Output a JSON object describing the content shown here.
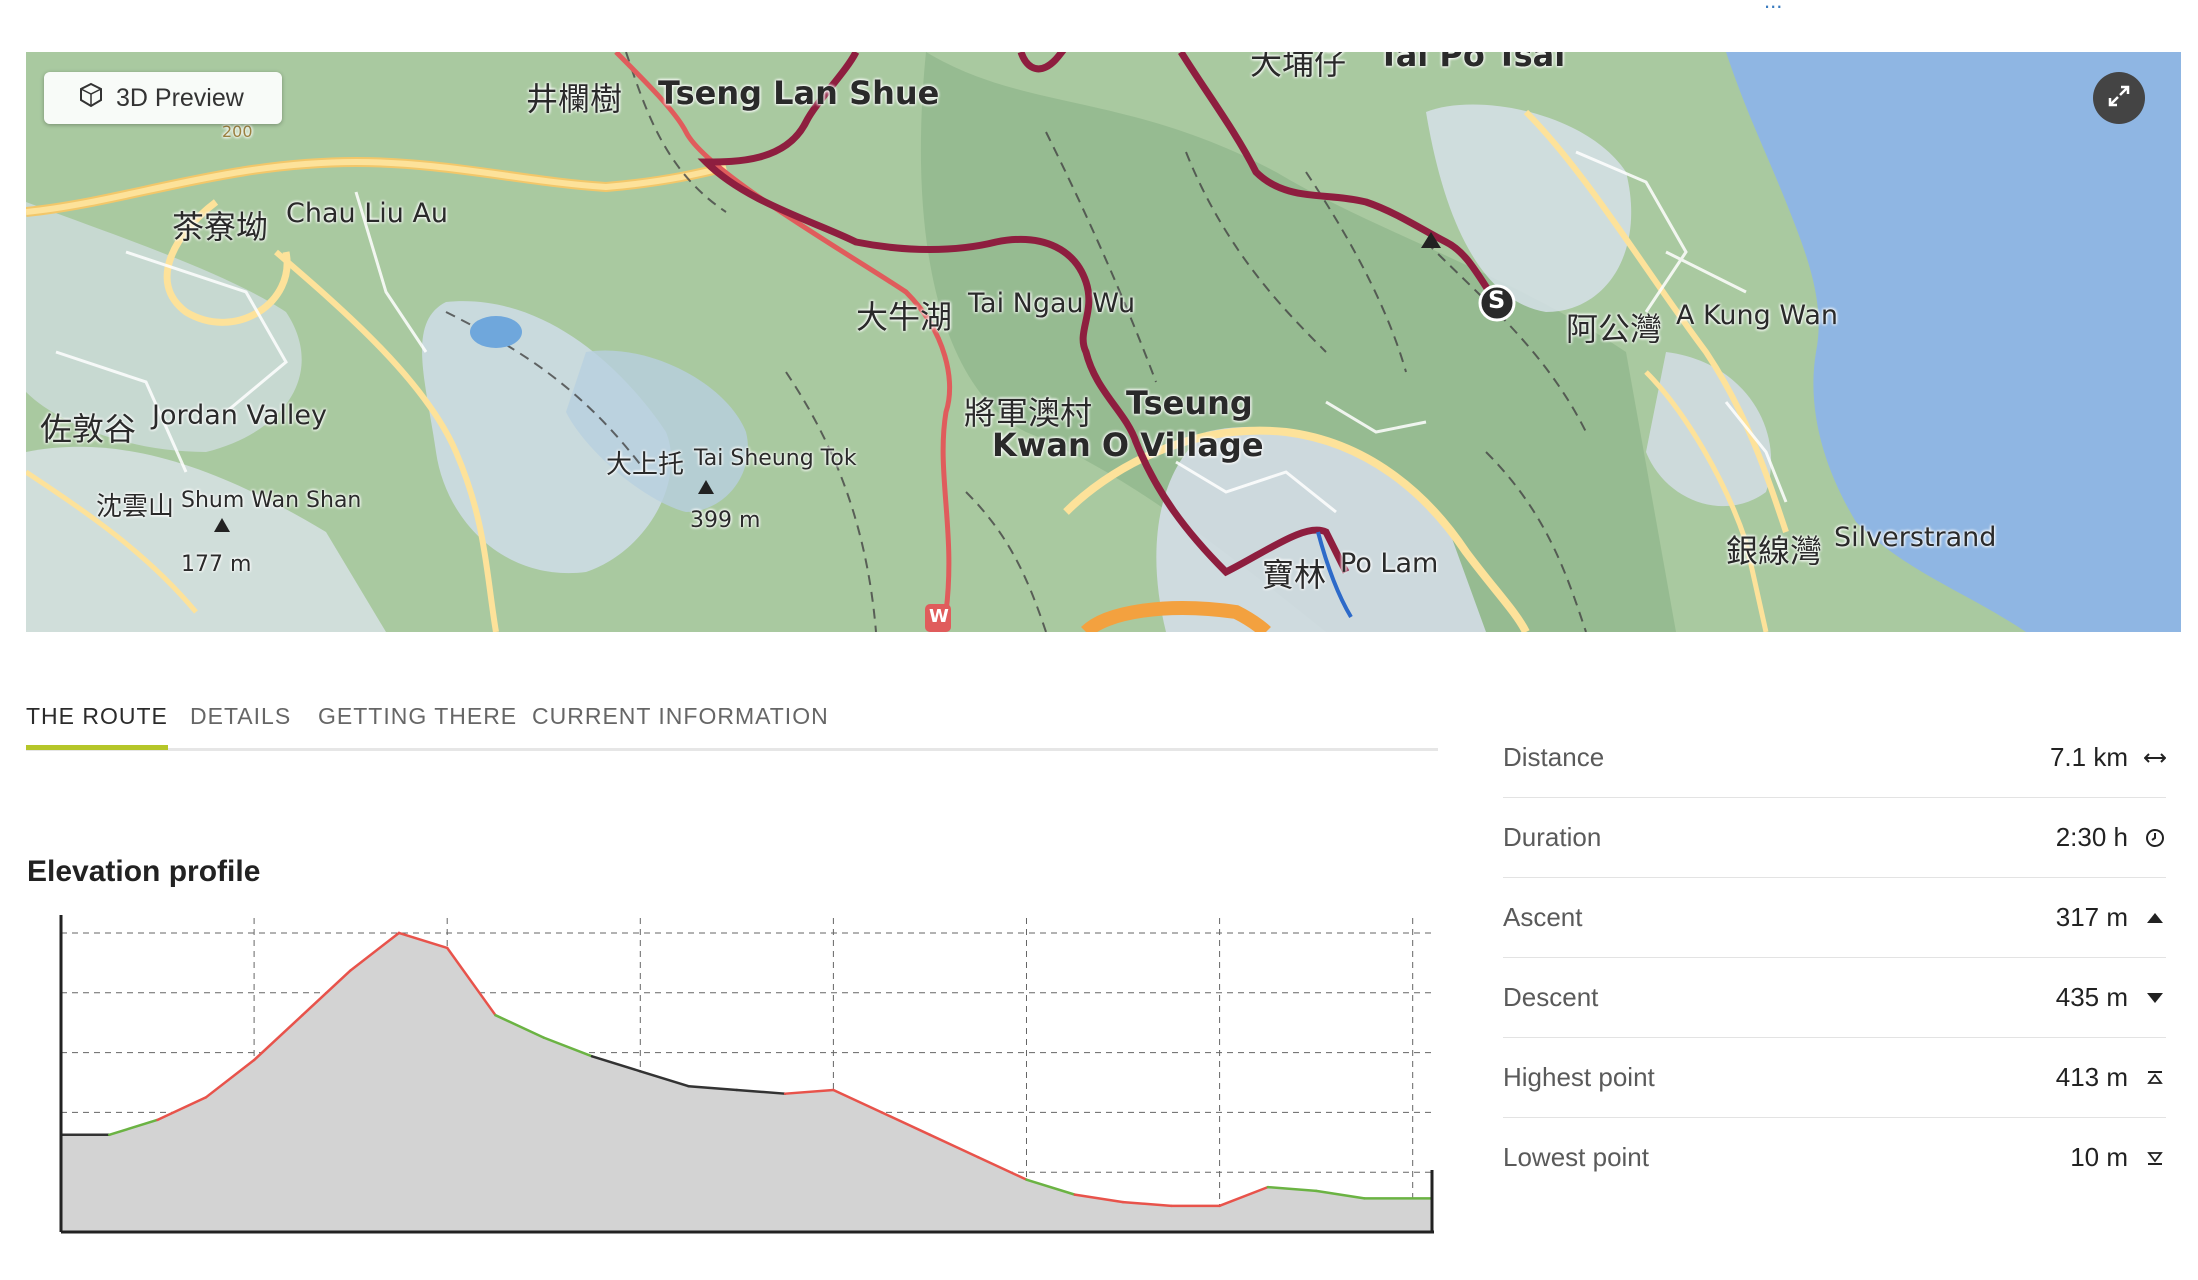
{
  "top_link": "...",
  "map": {
    "preview_button": "3D Preview",
    "labels": {
      "tseng_lan_shue_cn": "井欄樹",
      "tseng_lan_shue": "Tseng Lan Shue",
      "chau_liu_au_cn": "茶寮坳",
      "chau_liu_au": "Chau Liu Au",
      "tai_ngau_wu_cn": "大牛湖",
      "tai_ngau_wu": "Tai Ngau Wu",
      "tseung_kwan_o_cn": "將軍澳村",
      "tseung_kwan_o": "Tseung",
      "tseung_kwan_o_2": "Kwan O Village",
      "jordan_valley_cn": "佐敦谷",
      "jordan_valley": "Jordan Valley",
      "shum_wan_shan_cn": "沈雲山",
      "shum_wan_shan": "Shum Wan Shan",
      "shum_wan_shan_height": "177 m",
      "tai_sheung_tok_cn": "大上托",
      "tai_sheung_tok": "Tai Sheung Tok",
      "tai_sheung_tok_height": "399 m",
      "a_kung_wan_cn": "阿公灣",
      "a_kung_wan": "A Kung Wan",
      "po_lam_cn": "寶林",
      "po_lam": "Po Lam",
      "silverstrand_cn": "銀線灣",
      "silverstrand": "Silverstrand",
      "tai_po_tsai_cn": "大埔仔",
      "tai_po_tsai": "Tai Po Tsai",
      "road_200": "200"
    },
    "start_marker": "S",
    "trail_marker": "W"
  },
  "tabs": [
    {
      "label": "THE ROUTE",
      "active": true
    },
    {
      "label": "DETAILS",
      "active": false
    },
    {
      "label": "GETTING THERE",
      "active": false
    },
    {
      "label": "CURRENT INFORMATION",
      "active": false
    }
  ],
  "elevation": {
    "title": "Elevation profile"
  },
  "chart_data": {
    "type": "area",
    "title": "Elevation profile",
    "xlabel": "",
    "ylabel": "",
    "x": [
      0,
      0.25,
      0.5,
      0.75,
      1.0,
      1.25,
      1.5,
      1.75,
      2.0,
      2.25,
      2.5,
      2.75,
      3.0,
      3.25,
      3.5,
      3.75,
      4.0,
      4.25,
      4.5,
      4.75,
      5.0,
      5.25,
      5.5,
      5.75,
      6.0,
      6.25,
      6.5,
      6.75,
      7.1
    ],
    "y": [
      130,
      130,
      150,
      180,
      230,
      290,
      350,
      400,
      380,
      290,
      260,
      235,
      215,
      195,
      190,
      185,
      190,
      160,
      130,
      100,
      70,
      50,
      40,
      35,
      35,
      60,
      55,
      45,
      45
    ],
    "grade_colors": [
      "black",
      "black",
      "green",
      "red",
      "red",
      "red",
      "red",
      "red",
      "red",
      "red",
      "green",
      "green",
      "black",
      "black",
      "black",
      "black",
      "red",
      "red",
      "red",
      "red",
      "red",
      "green",
      "red",
      "red",
      "red",
      "red",
      "green",
      "green",
      "green"
    ],
    "ylim": [
      0,
      420
    ],
    "grid": true,
    "colors": {
      "fill": "#d3d3d3",
      "up": "#e8534b",
      "flat": "#6bb343",
      "down": "#333333"
    }
  },
  "stats": [
    {
      "label": "Distance",
      "value": "7.1 km",
      "icon": "distance-icon"
    },
    {
      "label": "Duration",
      "value": "2:30 h",
      "icon": "clock-icon"
    },
    {
      "label": "Ascent",
      "value": "317 m",
      "icon": "triangle-up-icon"
    },
    {
      "label": "Descent",
      "value": "435 m",
      "icon": "triangle-down-icon"
    },
    {
      "label": "Highest point",
      "value": "413 m",
      "icon": "highest-point-icon"
    },
    {
      "label": "Lowest point",
      "value": "10 m",
      "icon": "lowest-point-icon"
    }
  ],
  "colors": {
    "accent": "#b5c629",
    "route": "#8e1e3f",
    "water": "#8fb6e3",
    "terrain": "#9fbf95"
  }
}
